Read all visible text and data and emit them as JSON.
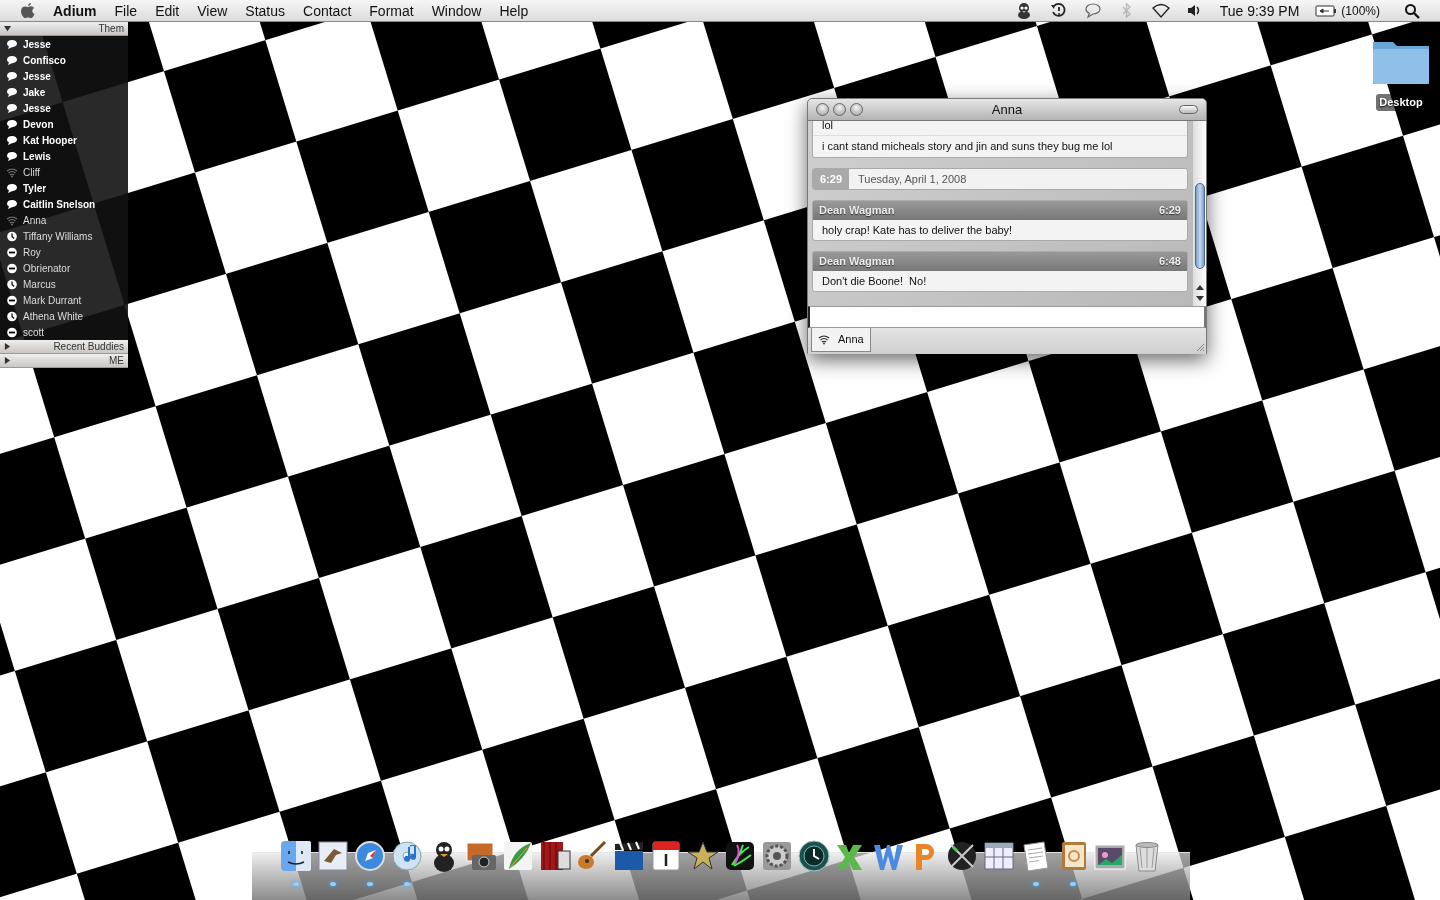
{
  "menu_bar": {
    "app_name": "Adium",
    "menus": [
      "File",
      "Edit",
      "View",
      "Status",
      "Contact",
      "Format",
      "Window",
      "Help"
    ],
    "extras": [
      {
        "kind": "adium",
        "disabled": false
      },
      {
        "kind": "time-machine",
        "disabled": false
      },
      {
        "kind": "chat",
        "disabled": false
      },
      {
        "kind": "bluetooth",
        "disabled": true
      },
      {
        "kind": "wifi",
        "disabled": false
      },
      {
        "kind": "volume",
        "disabled": false
      }
    ],
    "clock": "Tue 9:39 PM",
    "battery": "(100%)"
  },
  "contact_list": {
    "groups": [
      {
        "label": "Them",
        "expanded": true,
        "contacts": [
          {
            "name": "Jesse",
            "kind": "available"
          },
          {
            "name": "Confisco",
            "kind": "available"
          },
          {
            "name": "Jesse",
            "kind": "available"
          },
          {
            "name": "Jake",
            "kind": "available"
          },
          {
            "name": "Jesse",
            "kind": "available"
          },
          {
            "name": "Devon",
            "kind": "available"
          },
          {
            "name": "Kat Hooper",
            "kind": "available"
          },
          {
            "name": "Lewis",
            "kind": "available"
          },
          {
            "name": "Cliff",
            "kind": "mobile"
          },
          {
            "name": "Tyler",
            "kind": "available"
          },
          {
            "name": "Caitlin Snelson",
            "kind": "available"
          },
          {
            "name": "Anna",
            "kind": "mobile"
          },
          {
            "name": "Tiffany Williams",
            "kind": "idle"
          },
          {
            "name": "Roy",
            "kind": "away"
          },
          {
            "name": "Obrienator",
            "kind": "away"
          },
          {
            "name": "Marcus",
            "kind": "idle"
          },
          {
            "name": "Mark Durrant",
            "kind": "away"
          },
          {
            "name": "Athena White",
            "kind": "idle"
          },
          {
            "name": "scott",
            "kind": "away"
          }
        ]
      },
      {
        "label": "Recent Buddies",
        "expanded": false
      },
      {
        "label": "ME",
        "expanded": false
      }
    ]
  },
  "chat_window": {
    "title": "Anna",
    "transcript": [
      {
        "kind": "continuation",
        "lines": [
          "lol",
          "i cant stand micheals story and jin and suns they bug me lol"
        ]
      },
      {
        "kind": "date",
        "time": "6:29",
        "date": "Tuesday, April 1, 2008"
      },
      {
        "kind": "message",
        "sender": "Dean Wagman",
        "time": "6:29",
        "text": "holy crap! Kate has to deliver the baby!"
      },
      {
        "kind": "message",
        "sender": "Dean Wagman",
        "time": "6:48",
        "text": "Don't die Boone!  No!"
      }
    ],
    "tabs": [
      {
        "label": "Anna",
        "kind": "mobile",
        "selected": true
      }
    ]
  },
  "desktop_icons": [
    {
      "label": "Desktop",
      "kind": "folder"
    }
  ],
  "dock": {
    "items": [
      {
        "kind": "finder",
        "running": true
      },
      {
        "kind": "mail",
        "running": true
      },
      {
        "kind": "safari",
        "running": true
      },
      {
        "kind": "itunes",
        "running": true
      },
      {
        "kind": "adium",
        "running": false
      },
      {
        "kind": "iphoto",
        "running": false
      },
      {
        "kind": "feather",
        "running": false
      },
      {
        "kind": "photobooth",
        "running": false
      },
      {
        "kind": "guitar",
        "running": false
      },
      {
        "kind": "clapper",
        "running": false
      },
      {
        "kind": "calendar",
        "running": false
      },
      {
        "kind": "star",
        "running": false
      },
      {
        "kind": "spark",
        "running": false
      },
      {
        "kind": "prefs",
        "running": false
      },
      {
        "kind": "timemachine",
        "running": false
      },
      {
        "kind": "excel",
        "running": false
      },
      {
        "kind": "word",
        "running": false
      },
      {
        "kind": "powerpoint",
        "running": false
      },
      {
        "kind": "swords",
        "running": false
      },
      {
        "kind": "grid",
        "running": false
      },
      {
        "kind": "document",
        "running": true
      },
      {
        "kind": "addressbook",
        "running": true
      },
      {
        "kind": "photos",
        "running": false
      },
      {
        "kind": "trash",
        "running": false
      }
    ]
  }
}
